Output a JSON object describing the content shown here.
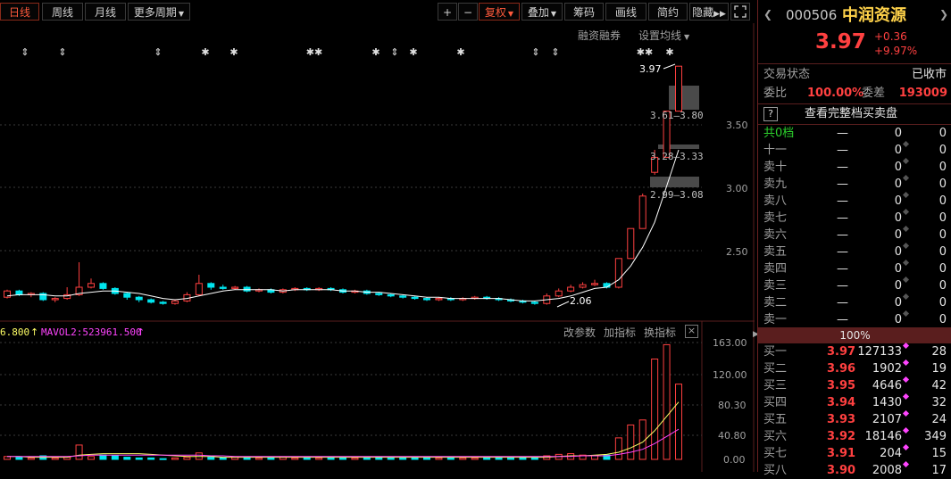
{
  "toolbar": {
    "tabs": [
      {
        "label": "日线",
        "active": true
      },
      {
        "label": "周线",
        "active": false
      },
      {
        "label": "月线",
        "active": false
      }
    ],
    "more_period": "更多周期",
    "plus": "+",
    "minus": "−",
    "fuquan": "复权",
    "diejia": "叠加",
    "chouma": "筹码",
    "huaxian": "画线",
    "jianyue": "简约",
    "yincang": "隐藏"
  },
  "chart": {
    "rzrq_label": "融资融券",
    "ma_settings_label": "设置均线",
    "price_ticks": [
      "3.50",
      "3.00",
      "2.50"
    ],
    "volume_ticks": [
      "163.00",
      "120.00",
      "80.30",
      "40.80",
      "0.00"
    ],
    "price_marks": {
      "high_label": "3.97",
      "low_label": "2.06",
      "band1": "3.61—3.80",
      "band2": "3.28—3.33",
      "band3": "2.99—3.08"
    },
    "volume_legend": {
      "ma1": "6.800",
      "ma2": "MAVOL2:523961.500"
    },
    "indicator_links": [
      "改参数",
      "加指标",
      "换指标"
    ],
    "close_label": "×",
    "event_markers": [
      "⇕",
      "⇕",
      "⇕",
      "✱",
      "✱",
      "✱✱",
      "✱",
      "⇕",
      "✱",
      "✱",
      "⇕",
      "⇕",
      "✱✱",
      "✱"
    ],
    "colors": {
      "up": "#ff4040",
      "down": "#00e5ee",
      "ma": "#ffffff",
      "vol_ma1": "#ffff66",
      "vol_ma2": "#ff44ff"
    }
  },
  "chart_data": {
    "type": "candlestick",
    "price_axis": [
      2.0,
      4.0
    ],
    "candles": [
      {
        "o": 2.12,
        "c": 2.17,
        "h": 2.18,
        "l": 2.11
      },
      {
        "o": 2.17,
        "c": 2.14,
        "h": 2.18,
        "l": 2.13
      },
      {
        "o": 2.14,
        "c": 2.15,
        "h": 2.16,
        "l": 2.12
      },
      {
        "o": 2.15,
        "c": 2.1,
        "h": 2.16,
        "l": 2.09
      },
      {
        "o": 2.1,
        "c": 2.11,
        "h": 2.12,
        "l": 2.08
      },
      {
        "o": 2.11,
        "c": 2.14,
        "h": 2.2,
        "l": 2.1
      },
      {
        "o": 2.14,
        "c": 2.2,
        "h": 2.4,
        "l": 2.13
      },
      {
        "o": 2.2,
        "c": 2.23,
        "h": 2.27,
        "l": 2.19
      },
      {
        "o": 2.23,
        "c": 2.19,
        "h": 2.24,
        "l": 2.18
      },
      {
        "o": 2.19,
        "c": 2.15,
        "h": 2.2,
        "l": 2.14
      },
      {
        "o": 2.15,
        "c": 2.12,
        "h": 2.16,
        "l": 2.1
      },
      {
        "o": 2.12,
        "c": 2.1,
        "h": 2.13,
        "l": 2.08
      },
      {
        "o": 2.1,
        "c": 2.08,
        "h": 2.11,
        "l": 2.07
      },
      {
        "o": 2.08,
        "c": 2.07,
        "h": 2.09,
        "l": 2.06
      },
      {
        "o": 2.07,
        "c": 2.09,
        "h": 2.1,
        "l": 2.06
      },
      {
        "o": 2.09,
        "c": 2.14,
        "h": 2.16,
        "l": 2.08
      },
      {
        "o": 2.14,
        "c": 2.23,
        "h": 2.3,
        "l": 2.13
      },
      {
        "o": 2.23,
        "c": 2.2,
        "h": 2.24,
        "l": 2.18
      },
      {
        "o": 2.2,
        "c": 2.19,
        "h": 2.22,
        "l": 2.18
      },
      {
        "o": 2.19,
        "c": 2.2,
        "h": 2.21,
        "l": 2.18
      },
      {
        "o": 2.2,
        "c": 2.17,
        "h": 2.21,
        "l": 2.16
      },
      {
        "o": 2.17,
        "c": 2.18,
        "h": 2.19,
        "l": 2.16
      },
      {
        "o": 2.18,
        "c": 2.16,
        "h": 2.19,
        "l": 2.15
      },
      {
        "o": 2.16,
        "c": 2.18,
        "h": 2.19,
        "l": 2.15
      },
      {
        "o": 2.18,
        "c": 2.19,
        "h": 2.2,
        "l": 2.17
      },
      {
        "o": 2.19,
        "c": 2.18,
        "h": 2.2,
        "l": 2.17
      },
      {
        "o": 2.18,
        "c": 2.19,
        "h": 2.2,
        "l": 2.17
      },
      {
        "o": 2.19,
        "c": 2.18,
        "h": 2.2,
        "l": 2.17
      },
      {
        "o": 2.18,
        "c": 2.16,
        "h": 2.19,
        "l": 2.15
      },
      {
        "o": 2.16,
        "c": 2.17,
        "h": 2.18,
        "l": 2.15
      },
      {
        "o": 2.17,
        "c": 2.15,
        "h": 2.18,
        "l": 2.14
      },
      {
        "o": 2.15,
        "c": 2.14,
        "h": 2.16,
        "l": 2.13
      },
      {
        "o": 2.14,
        "c": 2.13,
        "h": 2.15,
        "l": 2.12
      },
      {
        "o": 2.13,
        "c": 2.12,
        "h": 2.14,
        "l": 2.11
      },
      {
        "o": 2.12,
        "c": 2.11,
        "h": 2.13,
        "l": 2.1
      },
      {
        "o": 2.11,
        "c": 2.1,
        "h": 2.12,
        "l": 2.09
      },
      {
        "o": 2.1,
        "c": 2.11,
        "h": 2.12,
        "l": 2.09
      },
      {
        "o": 2.11,
        "c": 2.1,
        "h": 2.12,
        "l": 2.09
      },
      {
        "o": 2.1,
        "c": 2.11,
        "h": 2.12,
        "l": 2.09
      },
      {
        "o": 2.11,
        "c": 2.12,
        "h": 2.13,
        "l": 2.1
      },
      {
        "o": 2.12,
        "c": 2.11,
        "h": 2.13,
        "l": 2.1
      },
      {
        "o": 2.11,
        "c": 2.1,
        "h": 2.12,
        "l": 2.09
      },
      {
        "o": 2.1,
        "c": 2.09,
        "h": 2.11,
        "l": 2.08
      },
      {
        "o": 2.09,
        "c": 2.08,
        "h": 2.1,
        "l": 2.07
      },
      {
        "o": 2.08,
        "c": 2.07,
        "h": 2.09,
        "l": 2.06
      },
      {
        "o": 2.07,
        "c": 2.13,
        "h": 2.15,
        "l": 2.06
      },
      {
        "o": 2.13,
        "c": 2.17,
        "h": 2.19,
        "l": 2.12
      },
      {
        "o": 2.17,
        "c": 2.2,
        "h": 2.22,
        "l": 2.16
      },
      {
        "o": 2.2,
        "c": 2.22,
        "h": 2.24,
        "l": 2.19
      },
      {
        "o": 2.22,
        "c": 2.23,
        "h": 2.26,
        "l": 2.21
      },
      {
        "o": 2.23,
        "c": 2.2,
        "h": 2.24,
        "l": 2.19
      },
      {
        "o": 2.2,
        "c": 2.43,
        "h": 2.43,
        "l": 2.19
      },
      {
        "o": 2.43,
        "c": 2.67,
        "h": 2.67,
        "l": 2.43
      },
      {
        "o": 2.67,
        "c": 2.93,
        "h": 2.95,
        "l": 2.67
      },
      {
        "o": 3.12,
        "c": 3.24,
        "h": 3.3,
        "l": 3.1
      },
      {
        "o": 3.24,
        "c": 3.61,
        "h": 3.61,
        "l": 3.24
      },
      {
        "o": 3.61,
        "c": 3.97,
        "h": 3.97,
        "l": 3.61
      }
    ],
    "ma": [
      2.13,
      2.14,
      2.14,
      2.14,
      2.13,
      2.13,
      2.15,
      2.16,
      2.17,
      2.17,
      2.16,
      2.15,
      2.13,
      2.11,
      2.1,
      2.11,
      2.13,
      2.15,
      2.17,
      2.18,
      2.18,
      2.18,
      2.18,
      2.17,
      2.18,
      2.18,
      2.18,
      2.18,
      2.17,
      2.17,
      2.16,
      2.16,
      2.15,
      2.14,
      2.13,
      2.12,
      2.12,
      2.11,
      2.11,
      2.11,
      2.11,
      2.11,
      2.1,
      2.09,
      2.09,
      2.1,
      2.11,
      2.13,
      2.16,
      2.19,
      2.2,
      2.26,
      2.37,
      2.52,
      2.72,
      3.01,
      3.3
    ],
    "volumes": [
      4,
      3,
      2,
      5,
      2,
      3,
      20,
      4,
      6,
      5,
      3,
      2,
      2,
      1,
      2,
      3,
      9,
      3,
      2,
      3,
      2,
      2,
      2,
      3,
      2,
      2,
      2,
      2,
      2,
      2,
      2,
      3,
      2,
      2,
      2,
      2,
      2,
      2,
      2,
      2,
      2,
      2,
      2,
      3,
      2,
      5,
      7,
      8,
      6,
      5,
      6,
      30,
      48,
      55,
      140,
      160,
      105
    ],
    "vol_ma1": [
      4,
      4,
      3,
      3,
      3,
      3,
      6,
      7,
      8,
      8,
      8,
      8,
      7,
      6,
      5,
      4,
      4,
      4,
      3,
      3,
      3,
      3,
      3,
      3,
      3,
      3,
      3,
      3,
      3,
      3,
      3,
      3,
      3,
      3,
      3,
      3,
      3,
      3,
      3,
      3,
      3,
      3,
      3,
      3,
      3,
      3,
      4,
      5,
      5,
      6,
      7,
      10,
      16,
      24,
      40,
      60,
      80
    ],
    "vol_ma2": [
      4,
      4,
      4,
      4,
      4,
      4,
      5,
      6,
      6,
      6,
      6,
      6,
      6,
      6,
      6,
      6,
      6,
      5,
      5,
      4,
      4,
      4,
      4,
      4,
      4,
      4,
      4,
      4,
      4,
      4,
      4,
      4,
      4,
      4,
      4,
      4,
      4,
      4,
      4,
      4,
      4,
      4,
      4,
      4,
      4,
      4,
      4,
      4,
      5,
      5,
      5,
      7,
      10,
      14,
      22,
      32,
      42
    ]
  },
  "panel": {
    "code": "000506",
    "name": "中润资源",
    "price": "3.97",
    "change": "+0.36",
    "change_pct": "+9.97%",
    "trade_status_label": "交易状态",
    "trade_status_value": "已收市",
    "weibi_label": "委比",
    "weibi_value": "100.00%",
    "weicha_label": "委差",
    "weicha_value": "193009",
    "help_icon": "?",
    "full_book_label": "查看完整档买卖盘",
    "total_levels": "共0档",
    "sell_rows": [
      {
        "label": "十一",
        "price": "—",
        "vol": "0",
        "count": "0"
      },
      {
        "label": "卖十",
        "price": "—",
        "vol": "0",
        "count": "0"
      },
      {
        "label": "卖九",
        "price": "—",
        "vol": "0",
        "count": "0"
      },
      {
        "label": "卖八",
        "price": "—",
        "vol": "0",
        "count": "0"
      },
      {
        "label": "卖七",
        "price": "—",
        "vol": "0",
        "count": "0"
      },
      {
        "label": "卖六",
        "price": "—",
        "vol": "0",
        "count": "0"
      },
      {
        "label": "卖五",
        "price": "—",
        "vol": "0",
        "count": "0"
      },
      {
        "label": "卖四",
        "price": "—",
        "vol": "0",
        "count": "0"
      },
      {
        "label": "卖三",
        "price": "—",
        "vol": "0",
        "count": "0"
      },
      {
        "label": "卖二",
        "price": "—",
        "vol": "0",
        "count": "0"
      },
      {
        "label": "卖一",
        "price": "—",
        "vol": "0",
        "count": "0"
      }
    ],
    "center_pct": "100%",
    "buy_rows": [
      {
        "label": "买一",
        "price": "3.97",
        "vol": "127133",
        "count": "28"
      },
      {
        "label": "买二",
        "price": "3.96",
        "vol": "1902",
        "count": "19"
      },
      {
        "label": "买三",
        "price": "3.95",
        "vol": "4646",
        "count": "42"
      },
      {
        "label": "买四",
        "price": "3.94",
        "vol": "1430",
        "count": "32"
      },
      {
        "label": "买五",
        "price": "3.93",
        "vol": "2107",
        "count": "24"
      },
      {
        "label": "买六",
        "price": "3.92",
        "vol": "18146",
        "count": "349"
      },
      {
        "label": "买七",
        "price": "3.91",
        "vol": "204",
        "count": "15"
      },
      {
        "label": "买八",
        "price": "3.90",
        "vol": "2008",
        "count": "17"
      }
    ]
  }
}
